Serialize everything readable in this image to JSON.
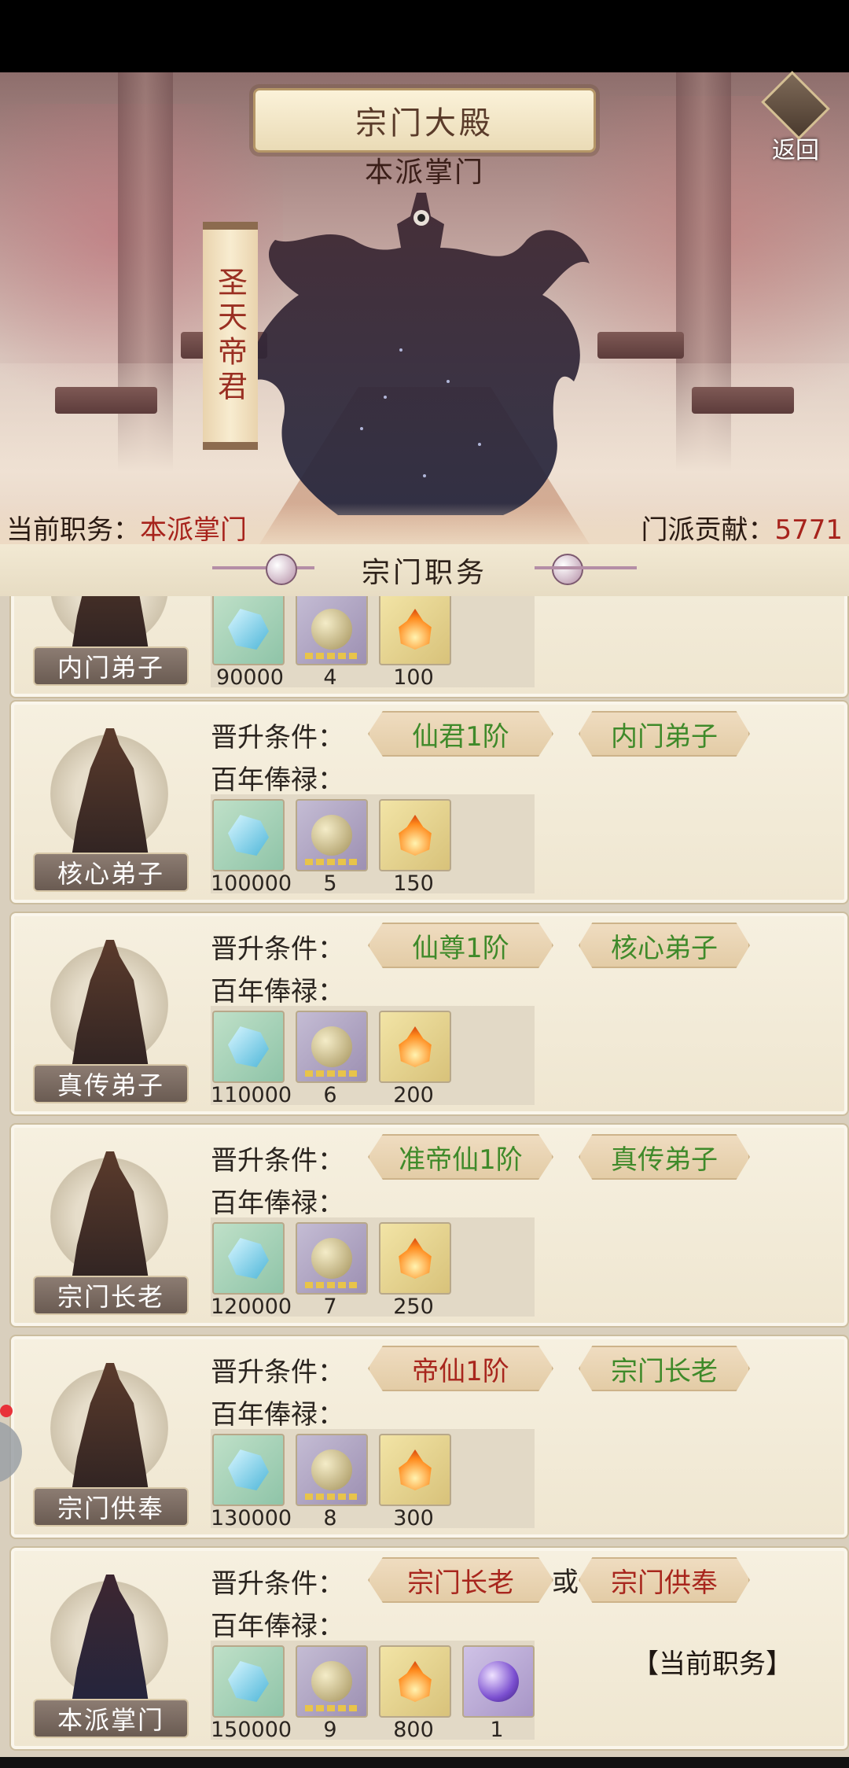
{
  "header": {
    "title": "宗门大殿",
    "master_caption": "本派掌门",
    "back_label": "返回",
    "master_name": "圣天帝君"
  },
  "info": {
    "position_label": "当前职务：",
    "position_value": "本派掌门",
    "contribution_label": "门派贡献：",
    "contribution_value": "5771"
  },
  "section": {
    "title": "宗门职务"
  },
  "labels": {
    "condition": "晋升条件：",
    "salary": "百年俸禄：",
    "or": "或",
    "current": "【当前职务】"
  },
  "ranks": [
    {
      "name": "内门弟子",
      "rewards": [
        "90000",
        "4",
        "100"
      ]
    },
    {
      "name": "核心弟子",
      "req1": "仙君1阶",
      "req1_color": "green",
      "req2": "内门弟子",
      "rewards": [
        "100000",
        "5",
        "150"
      ]
    },
    {
      "name": "真传弟子",
      "req1": "仙尊1阶",
      "req1_color": "green",
      "req2": "核心弟子",
      "rewards": [
        "110000",
        "6",
        "200"
      ]
    },
    {
      "name": "宗门长老",
      "req1": "准帝仙1阶",
      "req1_color": "green",
      "req2": "真传弟子",
      "rewards": [
        "120000",
        "7",
        "250"
      ]
    },
    {
      "name": "宗门供奉",
      "req1": "帝仙1阶",
      "req1_color": "red",
      "req2": "宗门长老",
      "rewards": [
        "130000",
        "8",
        "300"
      ]
    },
    {
      "name": "本派掌门",
      "req1": "宗门长老",
      "req1_color": "red",
      "req2": "宗门供奉",
      "req2_color": "red",
      "rewards": [
        "150000",
        "9",
        "800",
        "1"
      ]
    }
  ],
  "icons": [
    "crystal-icon",
    "spirit-orb-icon",
    "flame-icon",
    "purple-orb-icon"
  ],
  "colors": {
    "accent_red": "#a7231c",
    "accent_green": "#3f8a2a",
    "panel_bg": "#f6f0e0"
  }
}
